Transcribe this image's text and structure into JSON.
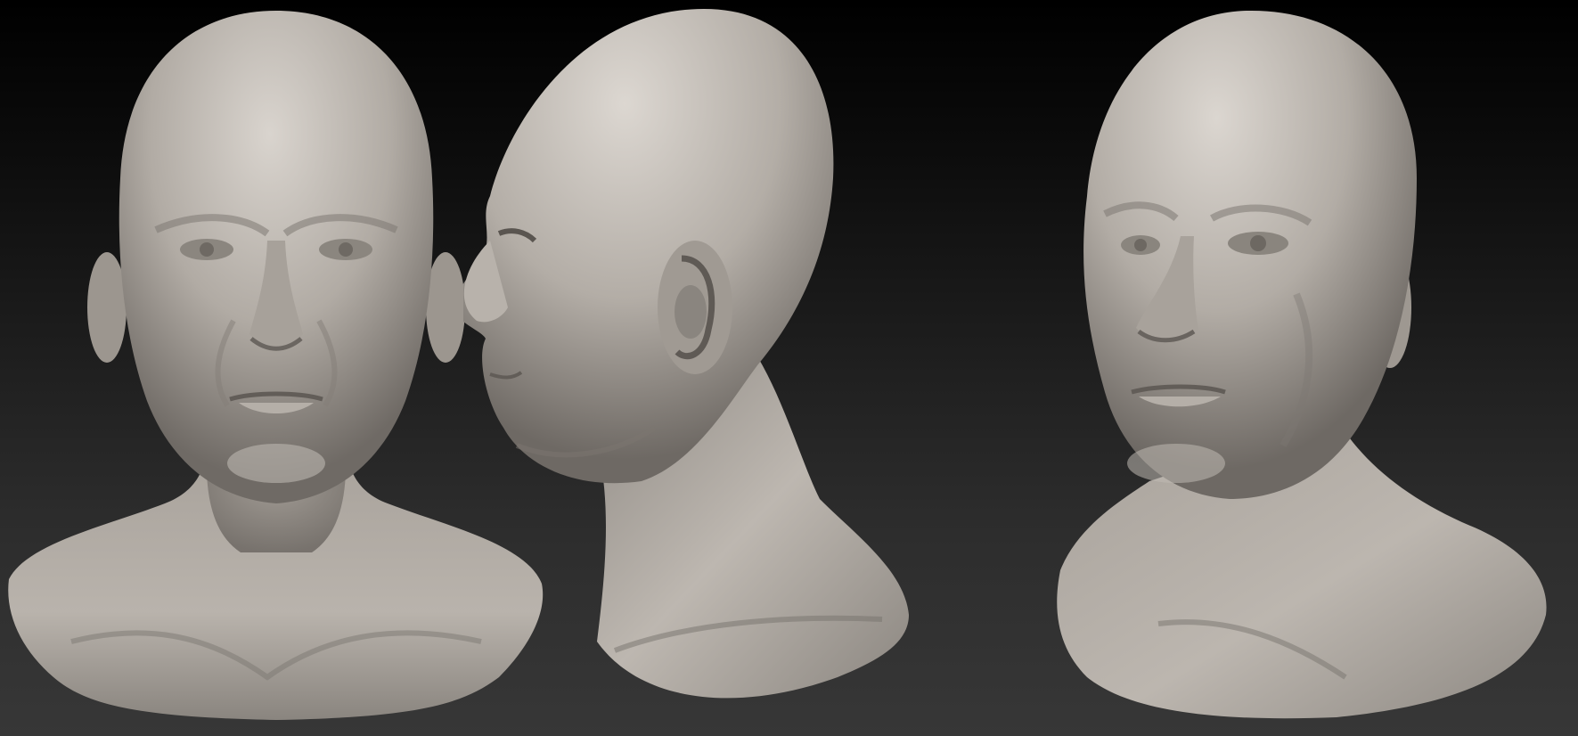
{
  "scene": {
    "background_top": "#000000",
    "background_bottom": "#373737",
    "clay_base": "#a9a39c",
    "clay_light": "#d8d3cd",
    "clay_shadow": "#5b5651"
  },
  "views": [
    {
      "id": "front",
      "kind": "front-view"
    },
    {
      "id": "side",
      "kind": "profile-view"
    },
    {
      "id": "three-quarter",
      "kind": "three-quarter-view"
    }
  ]
}
